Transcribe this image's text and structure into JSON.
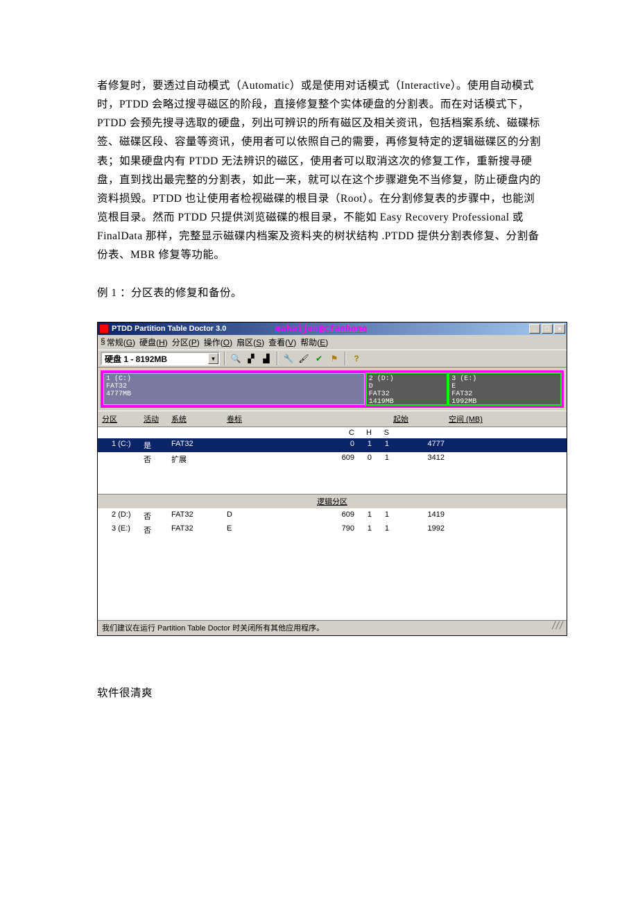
{
  "doc": {
    "para1": "者修复时，要透过自动模式（Automatic）或是使用对话模式（Interactive）。使用自动模式时，PTDD 会略过搜寻磁区的阶段，直接修复整个实体硬盘的分割表。而在对话模式下，PTDD 会预先搜寻选取的硬盘，列出可辨识的所有磁区及相关资讯，包括档案系统、磁碟标签、磁碟区段、容量等资讯，使用者可以依照自己的需要，再修复特定的逻辑磁碟区的分割表；如果硬盘内有 PTDD 无法辨识的磁区，使用者可以取消这次的修复工作，重新搜寻硬盘，直到找出最完整的分割表，如此一来，就可以在这个步骤避免不当修复，防止硬盘内的资料损毁。PTDD 也让使用者检视磁碟的根目录（Root）。在分割修复表的步骤中，也能浏览根目录。然而 PTDD 只提供浏览磁碟的根目录，不能如 Easy Recovery Professional 或 FinalData 那样，完整显示磁碟内档案及资料夹的树状结构 .PTDD 提供分割表修复、分割备份表、MBR 修复等功能。",
    "para2": "例 1 ：分区表的修复和备份。",
    "tail": "软件很清爽"
  },
  "app": {
    "title": "PTDD Partition Table Doctor 3.0",
    "watermark": "mahaijun@cfanhome",
    "menu": {
      "general": "常规",
      "general_k": "G",
      "disk": "硬盘",
      "disk_k": "H",
      "partition": "分区",
      "partition_k": "P",
      "operate": "操作",
      "operate_k": "O",
      "sector": "扇区",
      "sector_k": "S",
      "view": "查看",
      "view_k": "V",
      "help": "帮助",
      "help_k": "E"
    },
    "disk_selector": "硬盘 1 - 8192MB",
    "map": {
      "c": {
        "idx": "1",
        "drv": "(C:)",
        "label": "",
        "fs": "FAT32",
        "size": "4777MB"
      },
      "d": {
        "idx": "2",
        "drv": "(D:)",
        "label": "D",
        "fs": "FAT32",
        "size": "1419MB"
      },
      "e": {
        "idx": "3",
        "drv": "(E:)",
        "label": "E",
        "fs": "FAT32",
        "size": "1992MB"
      }
    },
    "columns": {
      "partition": "分区",
      "active": "活动",
      "system": "系统",
      "label": "卷标",
      "c": "C",
      "h": "H",
      "s": "S",
      "start": "起始",
      "space": "空间 (MB)"
    },
    "rows": {
      "r1": {
        "num": "1",
        "drv": "(C:)",
        "act": "是",
        "sys": "FAT32",
        "lbl": "",
        "c": "0",
        "h": "1",
        "s": "1",
        "sp": "4777"
      },
      "r2": {
        "num": "",
        "drv": "",
        "act": "否",
        "sys": "扩展",
        "lbl": "",
        "c": "609",
        "h": "0",
        "s": "1",
        "sp": "3412"
      }
    },
    "logical_header": "逻辑分区",
    "lrows": {
      "r1": {
        "num": "2",
        "drv": "(D:)",
        "act": "否",
        "sys": "FAT32",
        "lbl": "D",
        "c": "609",
        "h": "1",
        "s": "1",
        "sp": "1419"
      },
      "r2": {
        "num": "3",
        "drv": "(E:)",
        "act": "否",
        "sys": "FAT32",
        "lbl": "E",
        "c": "790",
        "h": "1",
        "s": "1",
        "sp": "1992"
      }
    },
    "status": "我们建议在运行 Partition Table Doctor 时关闭所有其他应用程序。"
  }
}
